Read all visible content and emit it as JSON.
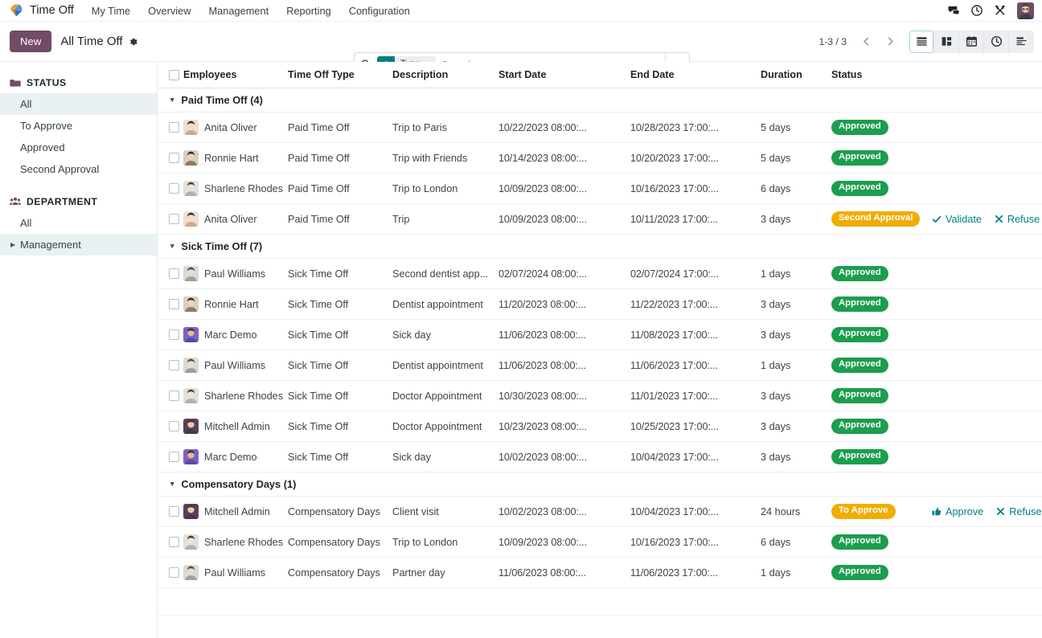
{
  "navbar": {
    "app_logo_icon": "time-off-umbrella-logo",
    "app_name": "Time Off",
    "menu_items": [
      {
        "label": "My Time"
      },
      {
        "label": "Overview"
      },
      {
        "label": "Management"
      },
      {
        "label": "Reporting"
      },
      {
        "label": "Configuration"
      }
    ],
    "systray": [
      {
        "icon": "messages-icon"
      },
      {
        "icon": "activities-clock-icon"
      },
      {
        "icon": "debug-tools-icon"
      },
      {
        "icon": "user-avatar"
      }
    ]
  },
  "control_panel": {
    "new_label": "New",
    "breadcrumb_title": "All Time Off",
    "settings_icon": "gear-icon",
    "search": {
      "search_icon": "search-icon",
      "facet_icon": "layers-icon",
      "facet_label": "Type",
      "facet_remove": "×",
      "placeholder": "Search...",
      "value": "",
      "dropdown_icon": "chevron-down-icon"
    },
    "pager": {
      "count": "1-3 / 3",
      "prev_icon": "chevron-left-icon",
      "next_icon": "chevron-right-icon"
    },
    "views": [
      {
        "name": "list-view",
        "icon": "list-icon",
        "active": true
      },
      {
        "name": "kanban-view",
        "icon": "kanban-icon",
        "active": false
      },
      {
        "name": "calendar-view",
        "icon": "calendar-icon",
        "active": false
      },
      {
        "name": "activity-view",
        "icon": "clock-icon",
        "active": false
      },
      {
        "name": "gantt-view",
        "icon": "gantt-icon",
        "active": false
      }
    ]
  },
  "sidebar": {
    "status": {
      "title": "STATUS",
      "icon": "folder-icon",
      "items": [
        {
          "label": "All",
          "selected": true
        },
        {
          "label": "To Approve",
          "selected": false
        },
        {
          "label": "Approved",
          "selected": false
        },
        {
          "label": "Second Approval",
          "selected": false
        }
      ]
    },
    "department": {
      "title": "DEPARTMENT",
      "icon": "people-icon",
      "items": [
        {
          "label": "All",
          "selected": false,
          "expandable": false
        },
        {
          "label": "Management",
          "selected": true,
          "expandable": true
        }
      ]
    }
  },
  "table": {
    "columns": [
      "Employees",
      "Time Off Type",
      "Description",
      "Start Date",
      "End Date",
      "Duration",
      "Status"
    ],
    "options_icon": "column-options-icon",
    "groups": [
      {
        "label": "Paid Time Off (4)",
        "rows": [
          {
            "employee": "Anita Oliver",
            "avatar": "anita",
            "type": "Paid Time Off",
            "description": "Trip to Paris",
            "start": "10/22/2023 08:00:...",
            "end": "10/28/2023 17:00:...",
            "duration": "5 days",
            "status": "Approved",
            "status_color": "green",
            "actions": []
          },
          {
            "employee": "Ronnie Hart",
            "avatar": "ronnie",
            "type": "Paid Time Off",
            "description": "Trip with Friends",
            "start": "10/14/2023 08:00:...",
            "end": "10/20/2023 17:00:...",
            "duration": "5 days",
            "status": "Approved",
            "status_color": "green",
            "actions": []
          },
          {
            "employee": "Sharlene Rhodes",
            "avatar": "sharlene",
            "type": "Paid Time Off",
            "description": "Trip to London",
            "start": "10/09/2023 08:00:...",
            "end": "10/16/2023 17:00:...",
            "duration": "6 days",
            "status": "Approved",
            "status_color": "green",
            "actions": []
          },
          {
            "employee": "Anita Oliver",
            "avatar": "anita",
            "type": "Paid Time Off",
            "description": "Trip",
            "start": "10/09/2023 08:00:...",
            "end": "10/11/2023 17:00:...",
            "duration": "3 days",
            "status": "Second Approval",
            "status_color": "orange",
            "actions": [
              {
                "label": "Validate",
                "icon": "check-icon"
              },
              {
                "label": "Refuse",
                "icon": "x-icon"
              }
            ]
          }
        ]
      },
      {
        "label": "Sick Time Off (7)",
        "rows": [
          {
            "employee": "Paul Williams",
            "avatar": "paul",
            "type": "Sick Time Off",
            "description": "Second dentist app...",
            "start": "02/07/2024 08:00:...",
            "end": "02/07/2024 17:00:...",
            "duration": "1 days",
            "status": "Approved",
            "status_color": "green",
            "actions": []
          },
          {
            "employee": "Ronnie Hart",
            "avatar": "ronnie",
            "type": "Sick Time Off",
            "description": "Dentist appointment",
            "start": "11/20/2023 08:00:...",
            "end": "11/22/2023 17:00:...",
            "duration": "3 days",
            "status": "Approved",
            "status_color": "green",
            "actions": []
          },
          {
            "employee": "Marc Demo",
            "avatar": "marc",
            "type": "Sick Time Off",
            "description": "Sick day",
            "start": "11/06/2023 08:00:...",
            "end": "11/08/2023 17:00:...",
            "duration": "3 days",
            "status": "Approved",
            "status_color": "green",
            "actions": []
          },
          {
            "employee": "Paul Williams",
            "avatar": "paul",
            "type": "Sick Time Off",
            "description": "Dentist appointment",
            "start": "11/06/2023 08:00:...",
            "end": "11/06/2023 17:00:...",
            "duration": "1 days",
            "status": "Approved",
            "status_color": "green",
            "actions": []
          },
          {
            "employee": "Sharlene Rhodes",
            "avatar": "sharlene",
            "type": "Sick Time Off",
            "description": "Doctor Appointment",
            "start": "10/30/2023 08:00:...",
            "end": "11/01/2023 17:00:...",
            "duration": "3 days",
            "status": "Approved",
            "status_color": "green",
            "actions": []
          },
          {
            "employee": "Mitchell Admin",
            "avatar": "mitchell",
            "type": "Sick Time Off",
            "description": "Doctor Appointment",
            "start": "10/23/2023 08:00:...",
            "end": "10/25/2023 17:00:...",
            "duration": "3 days",
            "status": "Approved",
            "status_color": "green",
            "actions": []
          },
          {
            "employee": "Marc Demo",
            "avatar": "marc",
            "type": "Sick Time Off",
            "description": "Sick day",
            "start": "10/02/2023 08:00:...",
            "end": "10/04/2023 17:00:...",
            "duration": "3 days",
            "status": "Approved",
            "status_color": "green",
            "actions": []
          }
        ]
      },
      {
        "label": "Compensatory Days (1)",
        "rows": [
          {
            "employee": "Mitchell Admin",
            "avatar": "mitchell",
            "type": "Compensatory Days",
            "description": "Client visit",
            "start": "10/02/2023 08:00:...",
            "end": "10/04/2023 17:00:...",
            "duration": "24 hours",
            "status": "To Approve",
            "status_color": "orange",
            "actions": [
              {
                "label": "Approve",
                "icon": "thumbs-up-icon"
              },
              {
                "label": "Refuse",
                "icon": "x-icon"
              }
            ]
          },
          {
            "employee": "Sharlene Rhodes",
            "avatar": "sharlene",
            "type": "Compensatory Days",
            "description": "Trip to London",
            "start": "10/09/2023 08:00:...",
            "end": "10/16/2023 17:00:...",
            "duration": "6 days",
            "status": "Approved",
            "status_color": "green",
            "actions": []
          },
          {
            "employee": "Paul Williams",
            "avatar": "paul",
            "type": "Compensatory Days",
            "description": "Partner day",
            "start": "11/06/2023 08:00:...",
            "end": "11/06/2023 17:00:...",
            "duration": "1 days",
            "status": "Approved",
            "status_color": "green",
            "actions": []
          }
        ]
      }
    ]
  },
  "colors": {
    "brand_purple": "#714b67",
    "teal": "#017e84",
    "badge_green": "#1d9d4e",
    "badge_orange": "#f0ad00"
  }
}
